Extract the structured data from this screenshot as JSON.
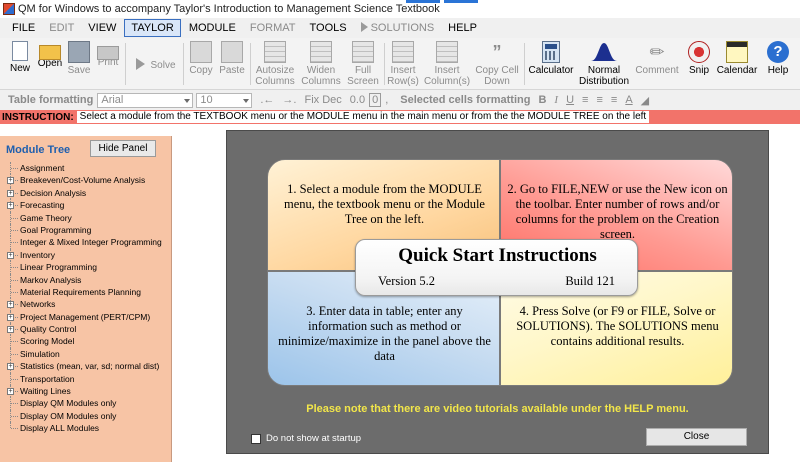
{
  "window": {
    "title": "QM for Windows to accompany Taylor's Introduction to Management Science Textbook"
  },
  "menu": [
    {
      "label": "FILE",
      "state": "normal"
    },
    {
      "label": "EDIT",
      "state": "disabled"
    },
    {
      "label": "VIEW",
      "state": "normal"
    },
    {
      "label": "TAYLOR",
      "state": "active"
    },
    {
      "label": "MODULE",
      "state": "normal"
    },
    {
      "label": "FORMAT",
      "state": "disabled"
    },
    {
      "label": "TOOLS",
      "state": "normal"
    },
    {
      "label": "SOLUTIONS",
      "state": "disabled"
    },
    {
      "label": "HELP",
      "state": "normal"
    }
  ],
  "toolbar": {
    "new": "New",
    "open": "Open",
    "save": "Save",
    "print": "Print",
    "solve": "Solve",
    "copy": "Copy",
    "paste": "Paste",
    "autosize_1": "Autosize",
    "autosize_2": "Columns",
    "widen_1": "Widen",
    "widen_2": "Columns",
    "full_1": "Full",
    "full_2": "Screen",
    "insert_row_1": "Insert",
    "insert_row_2": "Row(s)",
    "insert_col_1": "Insert",
    "insert_col_2": "Column(s)",
    "copy_cell_1": "Copy Cell",
    "copy_cell_2": "Down",
    "calculator": "Calculator",
    "normal_1": "Normal",
    "normal_2": "Distribution",
    "comment": "Comment",
    "snip": "Snip",
    "calendar": "Calendar",
    "help": "Help"
  },
  "format_bar": {
    "table_label": "Table formatting",
    "font": "Arial",
    "size": "10",
    "fixdec": "Fix Dec",
    "decimals": "0.0",
    "selected_label": "Selected cells formatting",
    "bold": "B",
    "italic": "I",
    "underline": "U"
  },
  "instruction": {
    "label": "INSTRUCTION:",
    "text": "Select a module from the TEXTBOOK menu or the MODULE menu in the main menu or from the the MODULE TREE on the left"
  },
  "module_tree": {
    "title": "Module Tree",
    "hide_button": "Hide Panel",
    "items": [
      {
        "label": "Assignment",
        "expandable": false
      },
      {
        "label": "Breakeven/Cost-Volume Analysis",
        "expandable": true
      },
      {
        "label": "Decision Analysis",
        "expandable": true
      },
      {
        "label": "Forecasting",
        "expandable": true
      },
      {
        "label": "Game Theory",
        "expandable": false
      },
      {
        "label": "Goal Programming",
        "expandable": false
      },
      {
        "label": "Integer & Mixed Integer Programming",
        "expandable": false
      },
      {
        "label": "Inventory",
        "expandable": true
      },
      {
        "label": "Linear Programming",
        "expandable": false
      },
      {
        "label": "Markov Analysis",
        "expandable": false
      },
      {
        "label": "Material Requirements Planning",
        "expandable": false
      },
      {
        "label": "Networks",
        "expandable": true
      },
      {
        "label": "Project Management (PERT/CPM)",
        "expandable": true
      },
      {
        "label": "Quality Control",
        "expandable": true
      },
      {
        "label": "Scoring Model",
        "expandable": false
      },
      {
        "label": "Simulation",
        "expandable": false
      },
      {
        "label": "Statistics (mean, var, sd; normal dist)",
        "expandable": true
      },
      {
        "label": "Transportation",
        "expandable": false
      },
      {
        "label": "Waiting Lines",
        "expandable": true
      },
      {
        "label": "Display QM Modules only",
        "expandable": false
      },
      {
        "label": "Display OM Modules only",
        "expandable": false
      },
      {
        "label": "Display ALL Modules",
        "expandable": false
      }
    ]
  },
  "quick_start": {
    "heading": "Quick Start Instructions",
    "version": "Version 5.2",
    "build": "Build 121",
    "step1": "1. Select a module from the MODULE menu, the textbook menu or the Module Tree on the left.",
    "step2": "2. Go to FILE,NEW or use the New icon on the toolbar. Enter number of rows and/or columns for the problem on the Creation screen.",
    "step3": "3. Enter data in table; enter any information such as method or minimize/maximize in the panel above the data",
    "step4": "4. Press Solve (or F9 or FILE, Solve or SOLUTIONS). The SOLUTIONS menu contains additional results.",
    "note": "Please note that there are video tutorials available under the HELP menu.",
    "checkbox_label": "Do not show at startup",
    "checkbox_checked": false,
    "close_button": "Close"
  },
  "colors": {
    "instruction_bar": "#f2736a",
    "tree_panel": "#f7c4a5",
    "dialog_bg": "#6c6c6c",
    "note_text": "#f2e64a",
    "tree_title": "#1f5fae"
  }
}
